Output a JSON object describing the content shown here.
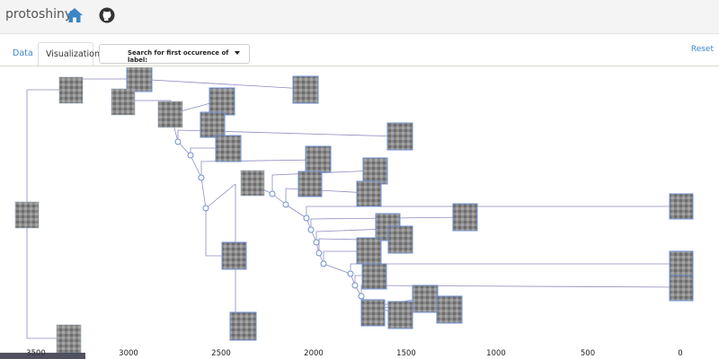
{
  "app": {
    "title": "protoshiny"
  },
  "icons": {
    "home": "home-icon",
    "github": "github-icon"
  },
  "tabs": [
    {
      "label": "Data"
    },
    {
      "label": "Visualization"
    }
  ],
  "dropdown": {
    "label": "Search for first occurence of label:"
  },
  "actions": {
    "reset": "Reset"
  },
  "colors": {
    "accent": "#3a86c8",
    "link_line": "#8d8bc0",
    "node": "#6f8fd0"
  },
  "axis": {
    "ticks": [
      "3500",
      "3000",
      "2500",
      "2000",
      "1500",
      "1000",
      "500",
      "0"
    ]
  }
}
